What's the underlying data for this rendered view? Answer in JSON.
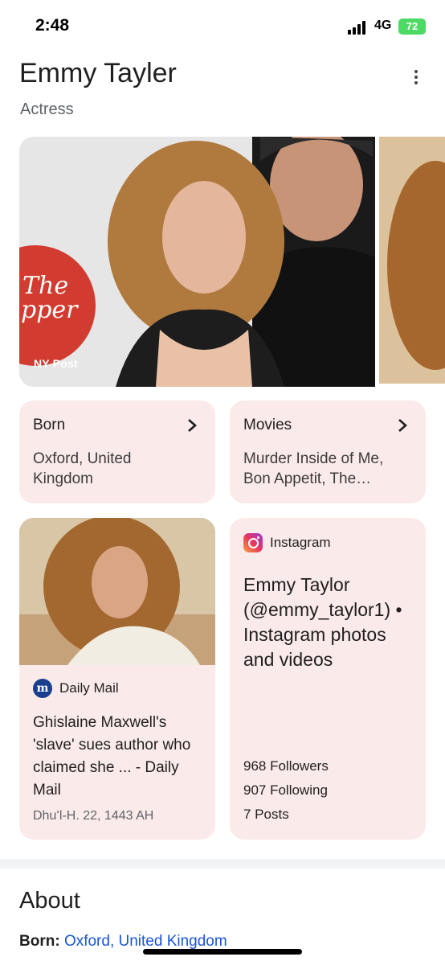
{
  "status_bar": {
    "time": "2:48",
    "network": "4G",
    "battery": "72"
  },
  "header": {
    "title": "Emmy Tayler",
    "subtitle": "Actress",
    "more_icon": "more-vert-icon"
  },
  "gallery": {
    "credit": "NY Post"
  },
  "born_card": {
    "label": "Born",
    "value": "Oxford, United Kingdom",
    "icon": "chevron-right-icon"
  },
  "movies_card": {
    "label": "Movies",
    "value": "Murder Inside of Me, Bon Appetit, The…",
    "icon": "chevron-right-icon"
  },
  "article_card": {
    "source": "Daily Mail",
    "source_icon": "daily-mail-logo",
    "title": "Ghislaine Maxwell's 'slave' sues author who claimed she ... - Daily Mail",
    "date": "Dhuʻl-H. 22, 1443 AH"
  },
  "instagram_card": {
    "source": "Instagram",
    "source_icon": "instagram-icon",
    "title": "Emmy Taylor (@emmy_taylor1) • Instagram photos and videos",
    "followers": "968 Followers",
    "following": "907 Following",
    "posts": "7 Posts"
  },
  "about": {
    "heading": "About",
    "born_label": "Born:",
    "born_link": "Oxford, United Kingdom"
  },
  "colors": {
    "card_bg": "#fbeaea",
    "link": "#1a55d6",
    "battery": "#4cd964"
  }
}
